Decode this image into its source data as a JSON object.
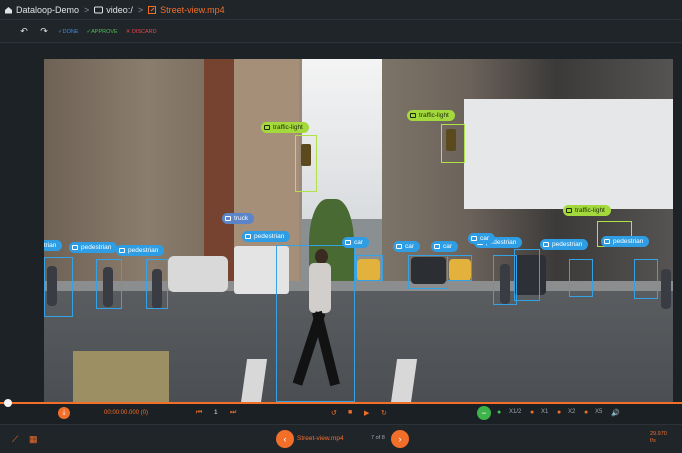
{
  "breadcrumb": {
    "project": "Dataloop-Demo",
    "dataset": "video:/",
    "file": "Street-view.mp4",
    "separator": ">"
  },
  "toolbar": {
    "undo_icon": "↶",
    "redo_icon": "↷",
    "done_label": "✓DONE",
    "approve_label": "✓APPROVE",
    "discard_label": "✕ DISCARD"
  },
  "annotations": [
    {
      "label": "traffic-light"
    },
    {
      "label": "traffic-light"
    },
    {
      "label": "traffic-light"
    },
    {
      "label": "truck"
    },
    {
      "label": "pedestrian"
    },
    {
      "label": "pedestrian"
    },
    {
      "label": "pedestrian"
    },
    {
      "label": "pedestrian"
    },
    {
      "label": "pedestrian"
    },
    {
      "label": "pedestrian"
    },
    {
      "label": "pedestrian"
    },
    {
      "label": "car"
    },
    {
      "label": "car"
    },
    {
      "label": "car"
    },
    {
      "label": "car"
    }
  ],
  "playback": {
    "progress_fraction": 0.0,
    "time": "00:00:00.000 (0)",
    "frame": "1",
    "speed_options": [
      "X1/2",
      "X1",
      "X2",
      "X5"
    ]
  },
  "footer": {
    "filename": "Street-view.mp4",
    "file_index": "7 of 8",
    "fps_value": "29.970",
    "fps_unit": "f/s"
  },
  "colors": {
    "accent": "#f26f2a",
    "box": "#36a2e6",
    "traffic_light": "#aee247",
    "done": "#3b8fe3",
    "approve": "#4bc14f",
    "discard": "#e5484d"
  }
}
